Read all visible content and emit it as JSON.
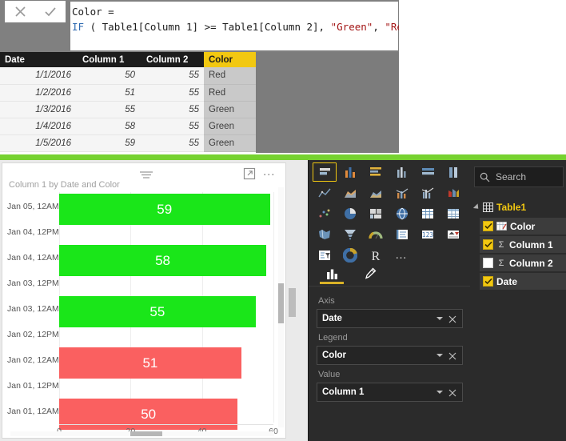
{
  "formula_bar": {
    "cancel_label": "cancel-edit",
    "commit_label": "commit-edit",
    "line1": "Color =",
    "line2_kw": "IF",
    "line2_a": " ( Table1[Column 1] >= Table1[Column 2], ",
    "line2_s1": "\"Green\"",
    "line2_mid": ", ",
    "line2_s2": "\"Red\"",
    "line2_end": " )"
  },
  "data_grid": {
    "columns": [
      "Date",
      "Column 1",
      "Column 2",
      "Color"
    ],
    "rows": [
      {
        "date": "1/1/2016",
        "c1": "50",
        "c2": "55",
        "color": "Red"
      },
      {
        "date": "1/2/2016",
        "c1": "51",
        "c2": "55",
        "color": "Red"
      },
      {
        "date": "1/3/2016",
        "c1": "55",
        "c2": "55",
        "color": "Green"
      },
      {
        "date": "1/4/2016",
        "c1": "58",
        "c2": "55",
        "color": "Green"
      },
      {
        "date": "1/5/2016",
        "c1": "59",
        "c2": "55",
        "color": "Green"
      }
    ]
  },
  "chart_card": {
    "title": "Column 1 by Date and Color",
    "filter_icon": "filter-icon",
    "focus_icon": "focus-mode-icon",
    "more_icon": "more-options-icon",
    "more_glyph": "…"
  },
  "chart_data": {
    "type": "bar",
    "orientation": "horizontal",
    "title": "Column 1 by Date and Color",
    "xlabel": "",
    "ylabel": "",
    "categories": [
      "Jan 05, 12AM",
      "Jan 04, 12PM",
      "Jan 04, 12AM",
      "Jan 03, 12PM",
      "Jan 03, 12AM",
      "Jan 02, 12PM",
      "Jan 02, 12AM",
      "Jan 01, 12PM",
      "Jan 01, 12AM"
    ],
    "values": [
      59,
      null,
      58,
      null,
      55,
      null,
      51,
      null,
      50
    ],
    "point_colors": [
      "Green",
      null,
      "Green",
      null,
      "Green",
      null,
      "Red",
      null,
      "Red"
    ],
    "data_labels": [
      "59",
      "",
      "58",
      "",
      "55",
      "",
      "51",
      "",
      "50"
    ],
    "xlim": [
      0,
      60
    ],
    "xticks": [
      "0",
      "20",
      "40",
      "60"
    ],
    "xtick_values": [
      0,
      20,
      40,
      60
    ],
    "grid": true,
    "legend": "Color",
    "colors": {
      "Green": "#1ae619",
      "Red": "#fa6060"
    }
  },
  "viz_pane": {
    "icons": [
      "stacked-bar-chart-icon",
      "stacked-column-chart-icon",
      "clustered-bar-chart-icon",
      "clustered-column-chart-icon",
      "pct-stacked-bar-chart-icon",
      "pct-stacked-column-chart-icon",
      "line-chart-icon",
      "area-chart-icon",
      "stacked-area-chart-icon",
      "line-stacked-column-chart-icon",
      "line-clustered-column-chart-icon",
      "ribbon-chart-icon",
      "scatter-chart-icon",
      "pie-chart-icon",
      "treemap-icon",
      "map-icon",
      "table-icon",
      "matrix-icon",
      "filled-map-icon",
      "funnel-chart-icon",
      "gauge-chart-icon",
      "multi-row-card-icon",
      "card-icon",
      "kpi-icon",
      "slicer-icon",
      "donut-chart-icon",
      "r-script-visual-icon",
      "more-visuals-icon"
    ],
    "selected_icon_index": 0,
    "tabs": [
      {
        "name": "fields-tab",
        "icon": "bar-chart-icon",
        "active": true
      },
      {
        "name": "format-tab",
        "icon": "paintbrush-icon",
        "active": false
      }
    ],
    "wells": [
      {
        "label": "Axis",
        "value": "Date"
      },
      {
        "label": "Legend",
        "value": "Color"
      },
      {
        "label": "Value",
        "value": "Column 1"
      }
    ]
  },
  "fields_pane": {
    "search_placeholder": "Search",
    "search_icon": "search-icon",
    "table": {
      "name": "Table1",
      "icon": "table-icon",
      "expanded": true
    },
    "fields": [
      {
        "name": "Color",
        "checked": true,
        "type": "calculated"
      },
      {
        "name": "Column 1",
        "checked": true,
        "type": "sigma"
      },
      {
        "name": "Column 2",
        "checked": false,
        "type": "sigma"
      },
      {
        "name": "Date",
        "checked": true,
        "type": "plain"
      }
    ]
  }
}
